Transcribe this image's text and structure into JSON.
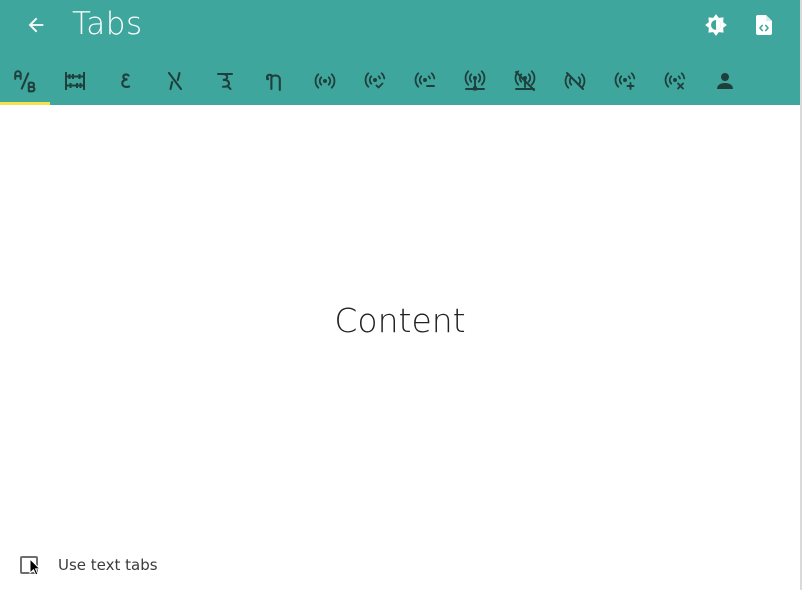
{
  "header": {
    "title": "Tabs",
    "back_icon": "arrow-left-icon",
    "theme_icon": "brightness-icon",
    "source_icon": "file-code-icon"
  },
  "tabs": [
    {
      "icon": "ab-testing-icon",
      "selected": true
    },
    {
      "icon": "abacus-icon",
      "selected": false
    },
    {
      "icon": "abjad-arabic-icon",
      "selected": false
    },
    {
      "icon": "abjad-hebrew-icon",
      "selected": false
    },
    {
      "icon": "abugida-devanagari-icon",
      "selected": false
    },
    {
      "icon": "abugida-thai-icon",
      "selected": false
    },
    {
      "icon": "access-point-icon",
      "selected": false
    },
    {
      "icon": "access-point-check-icon",
      "selected": false
    },
    {
      "icon": "access-point-minus-icon",
      "selected": false
    },
    {
      "icon": "access-point-network-icon",
      "selected": false
    },
    {
      "icon": "access-point-network-off-icon",
      "selected": false
    },
    {
      "icon": "access-point-off-icon",
      "selected": false
    },
    {
      "icon": "access-point-plus-icon",
      "selected": false
    },
    {
      "icon": "access-point-remove-icon",
      "selected": false
    },
    {
      "icon": "account-icon",
      "selected": false
    }
  ],
  "main": {
    "content_text": "Content"
  },
  "footer": {
    "checkbox_label": "Use text tabs",
    "checkbox_checked": false
  },
  "colors": {
    "appbar": "#3ea69d",
    "tab_indicator": "#f4e24d",
    "tab_icon": "#1f3f3c"
  }
}
